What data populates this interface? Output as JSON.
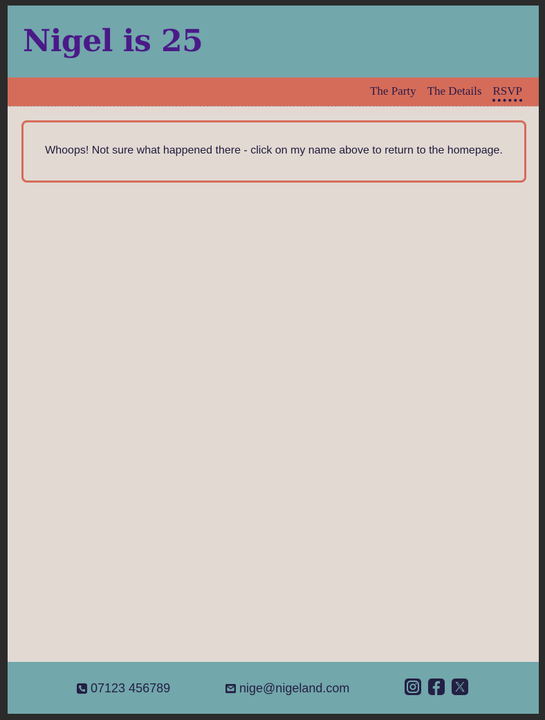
{
  "header": {
    "title": "Nigel is 25"
  },
  "nav": {
    "items": [
      {
        "label": "The Party",
        "active": false
      },
      {
        "label": "The Details",
        "active": false
      },
      {
        "label": "RSVP",
        "active": true
      }
    ]
  },
  "main": {
    "message": "Whoops! Not sure what happened there - click on my name above to return to the homepage."
  },
  "footer": {
    "phone": "07123 456789",
    "email": "nige@nigeland.com",
    "socials": [
      "instagram-icon",
      "facebook-icon",
      "x-twitter-icon"
    ]
  },
  "colors": {
    "header_bg": "#72a7ab",
    "nav_bg": "#d56c59",
    "page_bg": "#e2d9d3",
    "title": "#4a1a88",
    "text": "#232044",
    "accent_border": "#d56c59"
  }
}
